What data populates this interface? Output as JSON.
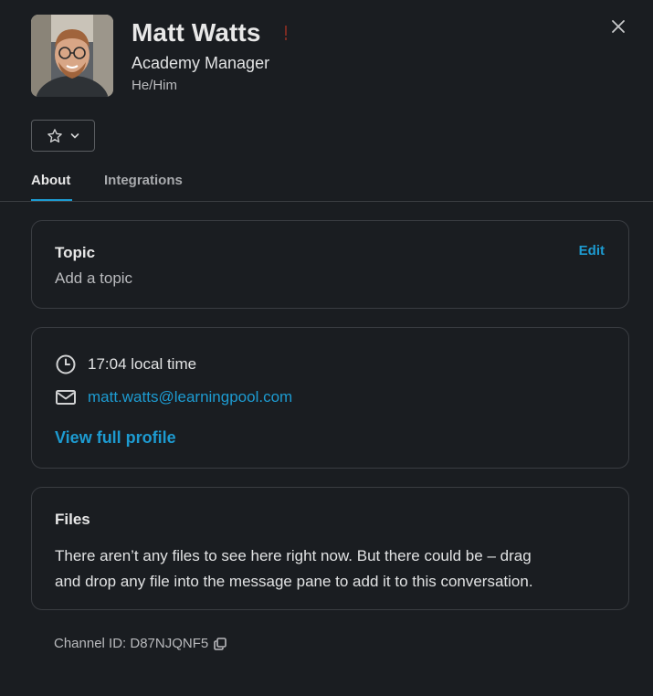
{
  "profile": {
    "name": "Matt Watts",
    "title": "Academy Manager",
    "pronouns": "He/Him"
  },
  "tabs": [
    {
      "label": "About",
      "active": true
    },
    {
      "label": "Integrations",
      "active": false
    }
  ],
  "topic": {
    "label": "Topic",
    "value": "Add a topic",
    "edit_label": "Edit"
  },
  "contact": {
    "local_time": "17:04 local time",
    "email": "matt.watts@learningpool.com",
    "view_profile_label": "View full profile"
  },
  "files": {
    "label": "Files",
    "text_line1": "There aren’t any files to see here right now. But there could be – drag",
    "text_line2": "and drop any file into the message pane to add it to this conversation."
  },
  "channel": {
    "text": "Channel ID: D87NJQNF5"
  },
  "icons": {
    "close": "close-icon",
    "star": "star-icon",
    "chevron": "chevron-down-icon",
    "clock": "clock-icon",
    "mail": "mail-icon",
    "copy": "copy-icon"
  },
  "colors": {
    "background": "#1a1d21",
    "accent_link": "#1d9bd1",
    "border": "#3a3d42"
  }
}
